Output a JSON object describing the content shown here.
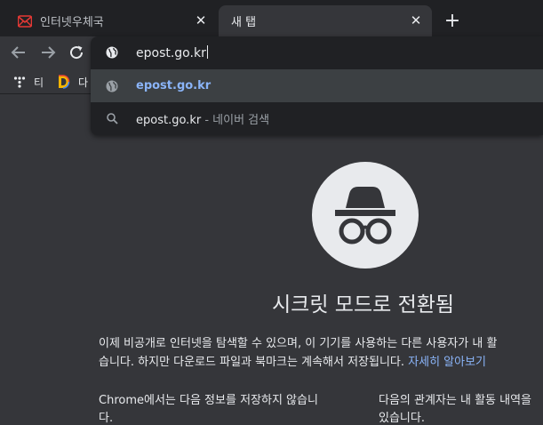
{
  "tabs": [
    {
      "title": "인터넷우체국",
      "favicon": "epost-icon",
      "active": false
    },
    {
      "title": "새 탭",
      "favicon": "",
      "active": true
    }
  ],
  "tab_close_glyph": "✕",
  "new_tab_glyph": "+",
  "bookmarks": [
    {
      "label": "티",
      "icon": "tistory-icon"
    },
    {
      "label": "다",
      "icon": "daum-icon"
    }
  ],
  "omnibox": {
    "input_value": "epost.go.kr",
    "suggestions": [
      {
        "text": "epost.go.kr",
        "icon": "globe-icon",
        "selected": true
      },
      {
        "text": "epost.go.kr",
        "suffix": " - 네이버 검색",
        "icon": "search-icon",
        "selected": false
      }
    ]
  },
  "incognito": {
    "title": "시크릿 모드로 전환됨",
    "para_line1": "이제 비공개로 인터넷을 탐색할 수 있으며, 이 기기를 사용하는 다른 사용자가 내 활",
    "para_line2": "습니다. 하지만 다운로드 파일과 북마크는 계속해서 저장됩니다. ",
    "learn_more": "자세히 알아보기",
    "col_left_line1": "Chrome에서는 다음 정보를 저장하지 않습니",
    "col_left_line2": "다.",
    "col_right_line1": "다음의 관계자는 내 활동 내역을",
    "col_right_line2": "있습니다."
  },
  "colors": {
    "page_bg": "#35363a",
    "tabstrip_bg": "#202124",
    "link": "#8ab4f8",
    "text": "#e8eaed"
  }
}
